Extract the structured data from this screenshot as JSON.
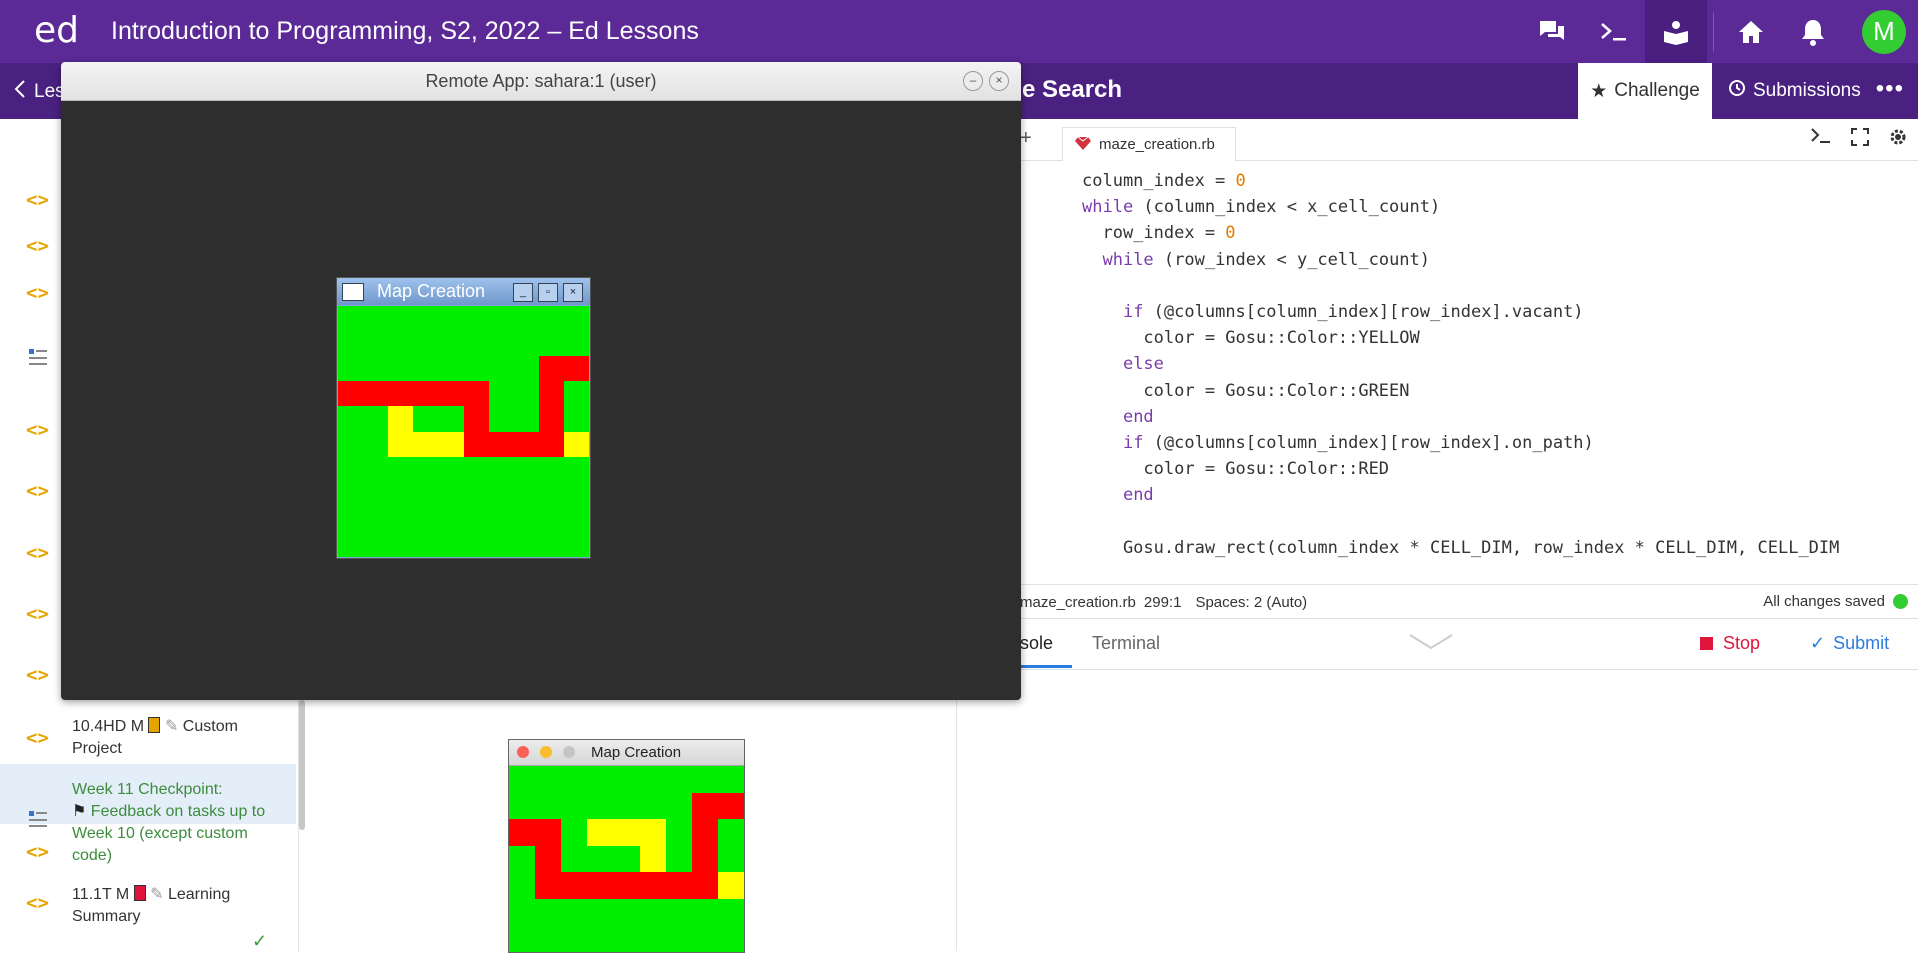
{
  "topbar": {
    "logo": "ed",
    "course_title": "Introduction to Programming, S2, 2022 – Ed Lessons",
    "avatar_letter": "M",
    "bg_color": "#5b2a97"
  },
  "subbar": {
    "back_label": "Les",
    "lesson_title": "e Search",
    "challenge_tab": "Challenge",
    "submissions_tab": "Submissions"
  },
  "sidebar": {
    "items": [
      {
        "label": "10.4HD M",
        "label2": "Custom Project"
      },
      {
        "label": "Week 11 Checkpoint:",
        "label2": "Feedback on tasks up to Week 10 (except custom code)"
      },
      {
        "label": "11.1T M",
        "label2": "Learning Summary"
      }
    ]
  },
  "remote_window": {
    "title": "Remote App: sahara:1 (user)"
  },
  "map_window": {
    "title": "Map Creation",
    "grid": [
      [
        "g",
        "g",
        "g",
        "g",
        "g",
        "g",
        "g",
        "g",
        "g",
        "g"
      ],
      [
        "g",
        "g",
        "g",
        "g",
        "g",
        "g",
        "g",
        "g",
        "g",
        "g"
      ],
      [
        "g",
        "g",
        "g",
        "g",
        "g",
        "g",
        "g",
        "g",
        "r",
        "r"
      ],
      [
        "r",
        "r",
        "r",
        "r",
        "r",
        "r",
        "g",
        "g",
        "r",
        "g"
      ],
      [
        "g",
        "g",
        "y",
        "g",
        "g",
        "r",
        "g",
        "g",
        "r",
        "g"
      ],
      [
        "g",
        "g",
        "y",
        "y",
        "y",
        "r",
        "r",
        "r",
        "r",
        "y"
      ],
      [
        "g",
        "g",
        "g",
        "g",
        "g",
        "g",
        "g",
        "g",
        "g",
        "g"
      ],
      [
        "g",
        "g",
        "g",
        "g",
        "g",
        "g",
        "g",
        "g",
        "g",
        "g"
      ],
      [
        "g",
        "g",
        "g",
        "g",
        "g",
        "g",
        "g",
        "g",
        "g",
        "g"
      ],
      [
        "g",
        "g",
        "g",
        "g",
        "g",
        "g",
        "g",
        "g",
        "g",
        "g"
      ]
    ]
  },
  "mac_map_window": {
    "title": "Map Creation",
    "grid": [
      [
        "g",
        "g",
        "g",
        "g",
        "g",
        "g",
        "g",
        "g",
        "g"
      ],
      [
        "g",
        "g",
        "g",
        "g",
        "g",
        "g",
        "g",
        "r",
        "r"
      ],
      [
        "r",
        "r",
        "g",
        "y",
        "y",
        "y",
        "g",
        "r",
        "g"
      ],
      [
        "g",
        "r",
        "g",
        "g",
        "g",
        "y",
        "g",
        "r",
        "g"
      ],
      [
        "g",
        "r",
        "r",
        "r",
        "r",
        "r",
        "r",
        "r",
        "y"
      ],
      [
        "g",
        "g",
        "g",
        "g",
        "g",
        "g",
        "g",
        "g",
        "g"
      ],
      [
        "g",
        "g",
        "g",
        "g",
        "g",
        "g",
        "g",
        "g",
        "g"
      ]
    ]
  },
  "editor": {
    "file_tab": "maze_creation.rb",
    "status_file": "maze_creation.rb",
    "cursor_pos": "299:1",
    "spaces": "Spaces: 2 (Auto)",
    "saved_status": "All changes saved",
    "console_tab": "sole",
    "terminal_tab": "Terminal",
    "stop_label": "Stop",
    "submit_label": "Submit"
  }
}
